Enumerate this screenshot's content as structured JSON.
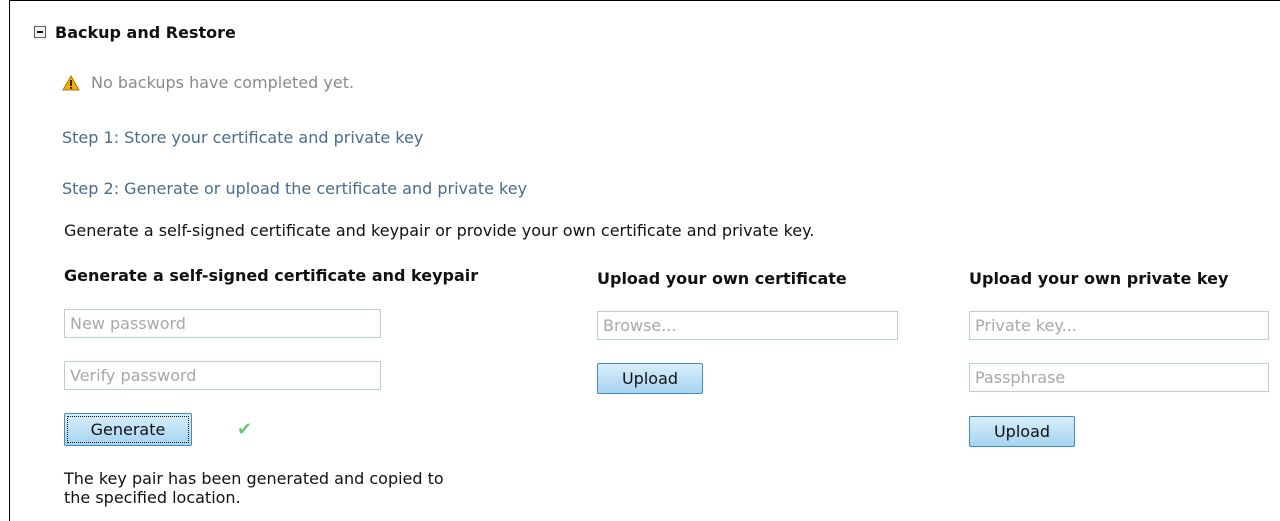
{
  "section": {
    "title": "Backup and Restore",
    "collapse_icon": "minus-box-icon"
  },
  "status": {
    "icon": "warning-icon",
    "text": "No backups have completed yet.",
    "warning_color": "#f0b000"
  },
  "steps": {
    "step1": "Step 1: Store your certificate and private key",
    "step2": "Step 2: Generate or upload the certificate and private key"
  },
  "description": "Generate a self-signed certificate and keypair or provide your own certificate and private key.",
  "generate": {
    "heading": "Generate a self-signed certificate and keypair",
    "new_password_placeholder": "New password",
    "verify_password_placeholder": "Verify password",
    "button_label": "Generate",
    "success_icon": "checkmark-icon",
    "success_note_line1": "The key pair has been generated and copied to",
    "success_note_line2": "the specified location."
  },
  "upload_certificate": {
    "heading": "Upload your own certificate",
    "browse_placeholder": "Browse...",
    "button_label": "Upload"
  },
  "upload_private_key": {
    "heading": "Upload your own private key",
    "key_placeholder": "Private key...",
    "passphrase_placeholder": "Passphrase",
    "button_label": "Upload"
  },
  "colors": {
    "step_link": "#4a6c8c",
    "button_border": "#3f8cc2",
    "field_border": "#b9cde0",
    "success_check": "#6cc47a"
  }
}
